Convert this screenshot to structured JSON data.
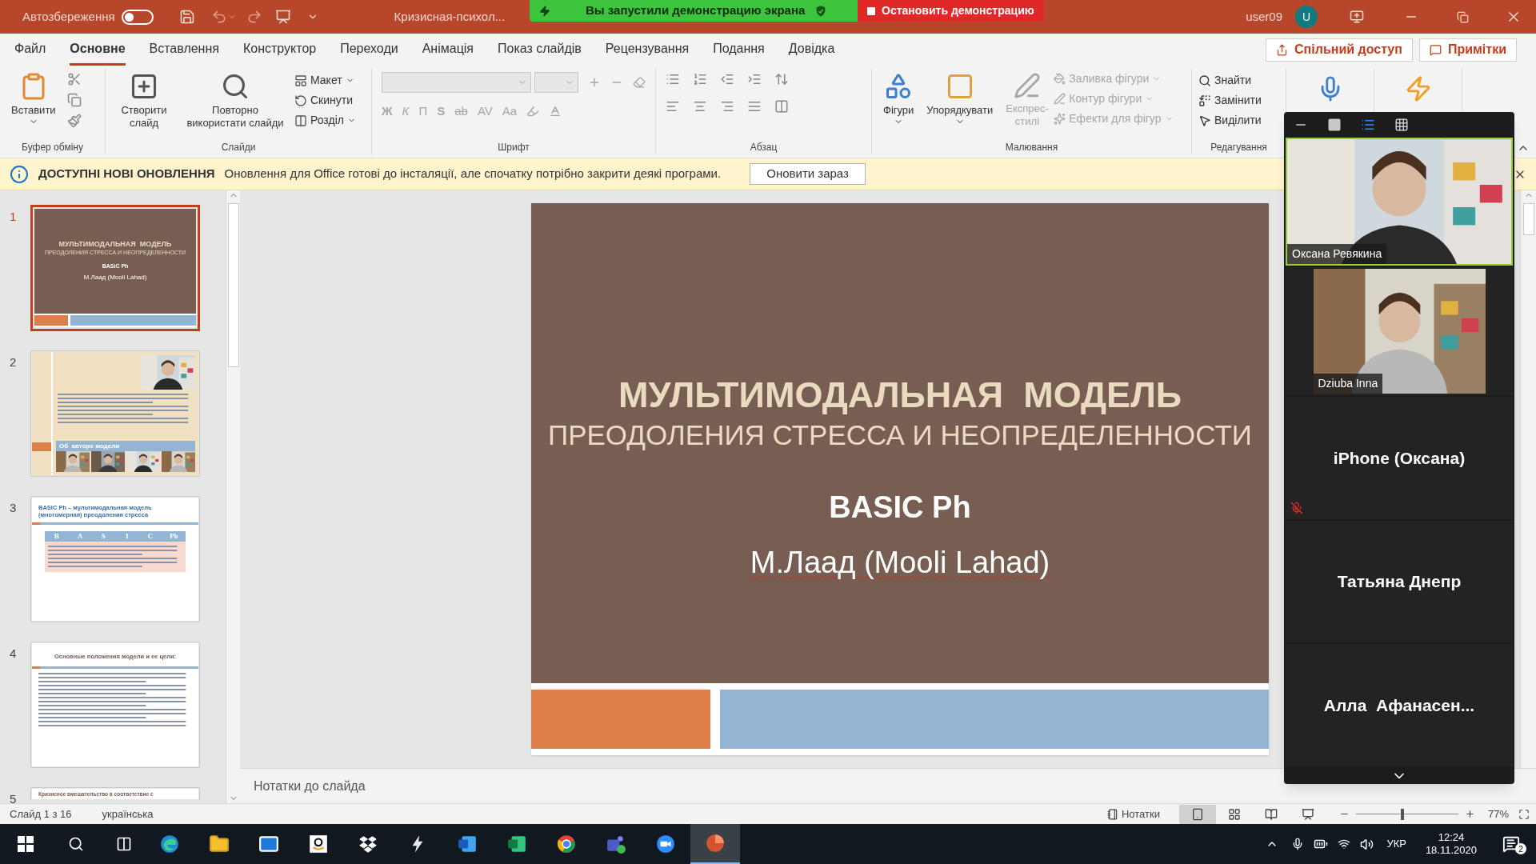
{
  "title_bar": {
    "autosave_label": "Автозбереження",
    "autosave_on": false,
    "document_title": "Кризисная-психол...",
    "user_name": "user09",
    "avatar_initial": "U"
  },
  "share_banner": {
    "message": "Вы запустили демонстрацию экрана",
    "stop_label": "Остановить демонстрацию"
  },
  "ribbon_tabs": [
    {
      "label": "Файл",
      "selected": false
    },
    {
      "label": "Основне",
      "selected": true
    },
    {
      "label": "Вставлення",
      "selected": false
    },
    {
      "label": "Конструктор",
      "selected": false
    },
    {
      "label": "Переходи",
      "selected": false
    },
    {
      "label": "Анімація",
      "selected": false
    },
    {
      "label": "Показ слайдів",
      "selected": false
    },
    {
      "label": "Рецензування",
      "selected": false
    },
    {
      "label": "Подання",
      "selected": false
    },
    {
      "label": "Довідка",
      "selected": false
    }
  ],
  "ribbon_actions": {
    "share": "Спільний доступ",
    "comments": "Примітки"
  },
  "clipboard_group": {
    "name": "Буфер обміну",
    "paste": "Вставити"
  },
  "slides_group": {
    "name": "Слайди",
    "new_slide": "Створити слайд",
    "reuse": "Повторно використати слайди",
    "items": [
      "Макет",
      "Скинути",
      "Розділ"
    ]
  },
  "font_group": {
    "name": "Шрифт",
    "disabled": true,
    "format_buttons": [
      "Ж",
      "К",
      "П",
      "S",
      "ab",
      "AV",
      "Aa"
    ]
  },
  "paragraph_group": {
    "name": "Абзац"
  },
  "drawing_group": {
    "name": "Малювання",
    "shapes": "Фігури",
    "arrange": "Упорядкувати",
    "quick_styles": {
      "label": "Експрес-стилі",
      "disabled": true
    },
    "items": [
      {
        "label": "Заливка фігури",
        "disabled": true
      },
      {
        "label": "Контур фігури",
        "disabled": true
      },
      {
        "label": "Ефекти для фігур",
        "disabled": true
      }
    ]
  },
  "editing_group": {
    "name": "Редагування",
    "items": [
      {
        "label": "Знайти"
      },
      {
        "label": "Замінити"
      },
      {
        "label": "Виділити"
      }
    ]
  },
  "notification": {
    "title": "ДОСТУПНІ НОВІ ОНОВЛЕННЯ",
    "message": "Оновлення для Office готові до інсталяції, але спочатку потрібно закрити деякі програми.",
    "button": "Оновити зараз"
  },
  "thumbnails": [
    {
      "number": "1",
      "selected": true,
      "kind": "title",
      "heading": "МУЛЬТИМОДАЛЬНАЯ  МОДЕЛЬ",
      "subheading": "ПРЕОДОЛЕНИЯ СТРЕССА И НЕОПРЕДЕЛЕННОСТИ",
      "code": "BASIC Ph",
      "author": "М.Лаад (Mooli Lahad)"
    },
    {
      "number": "2",
      "selected": false,
      "kind": "author",
      "caption": "Об  авторе модели"
    },
    {
      "number": "3",
      "selected": false,
      "kind": "table",
      "title": "BASIC Ph – мультимодальная модель (многомерная) преодоления стресса",
      "headers": [
        "B",
        "A",
        "S",
        "I",
        "C",
        "Ph"
      ]
    },
    {
      "number": "4",
      "selected": false,
      "kind": "list",
      "title": "Основные положения модели и ее цели:"
    },
    {
      "number": "5",
      "selected": false,
      "kind": "partial",
      "title": "Кризисное вмешательство в соответствие с"
    }
  ],
  "slide": {
    "heading": "МУЛЬТИМОДАЛЬНАЯ  МОДЕЛЬ",
    "subheading": "ПРЕОДОЛЕНИЯ СТРЕССА И НЕОПРЕДЕЛЕННОСТИ",
    "code": "BASIC Ph",
    "author": "М.Лаад (Mooli Lahad)"
  },
  "notes": {
    "placeholder": "Нотатки до слайда"
  },
  "status_bar": {
    "slide_info": "Слайд 1 з 16",
    "language": "українська",
    "notes_label": "Нотатки",
    "views": [
      {
        "selected": true
      },
      {
        "selected": false
      },
      {
        "selected": false
      },
      {
        "selected": false
      }
    ],
    "zoom": {
      "level": 0.45,
      "reading": "77%"
    }
  },
  "zoom_panel": {
    "views": [
      {
        "selected": false
      },
      {
        "selected": false
      },
      {
        "selected": true
      },
      {
        "selected": false
      }
    ],
    "participants": [
      {
        "kind": "video",
        "name": "Оксана Ревякина",
        "active": true,
        "muted": false
      },
      {
        "kind": "video",
        "name": "Dziuba Inna",
        "active": false,
        "muted": false
      },
      {
        "kind": "name",
        "name": "iPhone (Оксана)",
        "active": false,
        "muted": true
      },
      {
        "kind": "name",
        "name": "Татьяна Днепр",
        "active": false,
        "muted": false
      },
      {
        "kind": "name",
        "name": "Алла  Афанасен...",
        "active": false,
        "muted": false
      }
    ]
  },
  "taskbar": {
    "apps": [
      {
        "selected": false
      },
      {
        "selected": false
      },
      {
        "selected": false
      },
      {
        "selected": false
      },
      {
        "selected": false
      },
      {
        "selected": false
      },
      {
        "selected": false
      },
      {
        "selected": false
      },
      {
        "selected": false
      },
      {
        "selected": false
      },
      {
        "selected": false
      },
      {
        "selected": true
      }
    ],
    "language": "УКР",
    "time": "12:24",
    "date": "18.11.2020",
    "notifications": "2"
  }
}
